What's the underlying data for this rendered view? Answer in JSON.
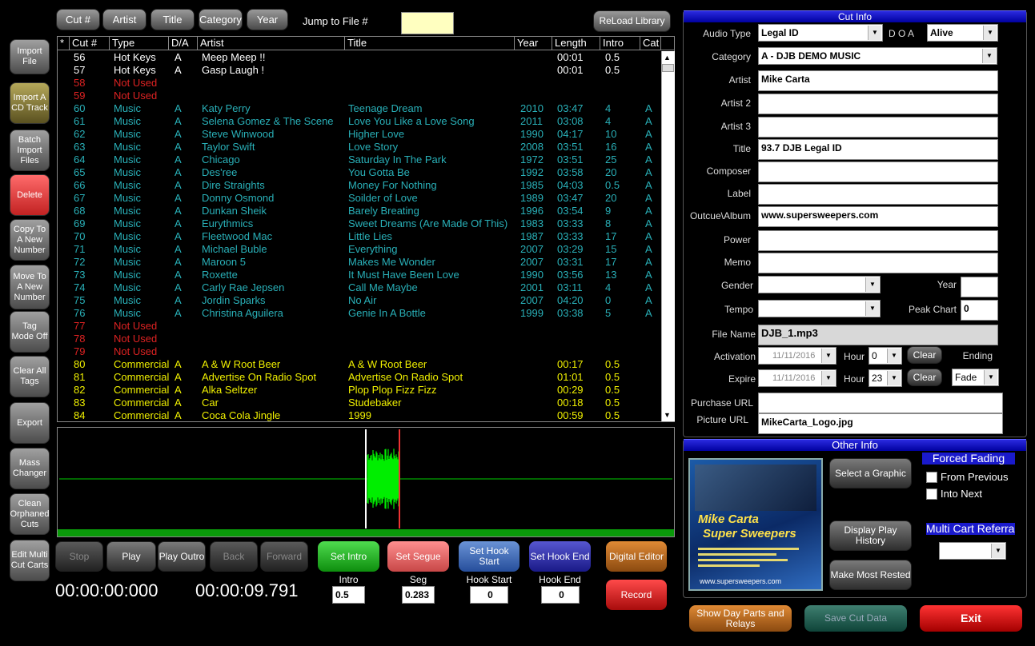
{
  "toolbar": {
    "cut": "Cut #",
    "artist": "Artist",
    "title": "Title",
    "category": "Category",
    "year": "Year",
    "jump_label": "Jump to  File #",
    "jump_value": "",
    "reload": "ReLoad Library"
  },
  "sidebar": [
    "Import File",
    "Import A CD Track",
    "Batch Import Files",
    "Delete",
    "Copy To A New Number",
    "Move To A New Number",
    "Tag Mode Off",
    "Clear All Tags",
    "Export",
    "Mass Changer",
    "Clean Orphaned Cuts",
    "Edit Multi Cut Carts"
  ],
  "table": {
    "headers": [
      "*",
      "Cut #",
      "Type",
      "D/A",
      "Artist",
      "Title",
      "Year",
      "Length",
      "Intro",
      "Cat"
    ],
    "rows": [
      {
        "cut": "56",
        "type": "Hot Keys",
        "da": "A",
        "artist": "Meep Meep !!",
        "title": "",
        "year": "",
        "length": "00:01",
        "intro": "0.5",
        "cat": "",
        "color": "white"
      },
      {
        "cut": "57",
        "type": "Hot Keys",
        "da": "A",
        "artist": "Gasp Laugh !",
        "title": "",
        "year": "",
        "length": "00:01",
        "intro": "0.5",
        "cat": "",
        "color": "white"
      },
      {
        "cut": "58",
        "type": "Not Used",
        "da": "",
        "artist": "",
        "title": "",
        "year": "",
        "length": "",
        "intro": "",
        "cat": "",
        "color": "red"
      },
      {
        "cut": "59",
        "type": "Not Used",
        "da": "",
        "artist": "",
        "title": "",
        "year": "",
        "length": "",
        "intro": "",
        "cat": "",
        "color": "red"
      },
      {
        "cut": "60",
        "type": "Music",
        "da": "A",
        "artist": "Katy Perry",
        "title": "Teenage Dream",
        "year": "2010",
        "length": "03:47",
        "intro": "4",
        "cat": "A",
        "color": "teal"
      },
      {
        "cut": "61",
        "type": "Music",
        "da": "A",
        "artist": "Selena Gomez & The Scene",
        "title": "Love You Like a Love Song",
        "year": "2011",
        "length": "03:08",
        "intro": "4",
        "cat": "A",
        "color": "teal"
      },
      {
        "cut": "62",
        "type": "Music",
        "da": "A",
        "artist": "Steve Winwood",
        "title": "Higher Love",
        "year": "1990",
        "length": "04:17",
        "intro": "10",
        "cat": "A",
        "color": "teal"
      },
      {
        "cut": "63",
        "type": "Music",
        "da": "A",
        "artist": "Taylor Swift",
        "title": "Love Story",
        "year": "2008",
        "length": "03:51",
        "intro": "16",
        "cat": "A",
        "color": "teal"
      },
      {
        "cut": "64",
        "type": "Music",
        "da": "A",
        "artist": "Chicago",
        "title": "Saturday In The Park",
        "year": "1972",
        "length": "03:51",
        "intro": "25",
        "cat": "A",
        "color": "teal"
      },
      {
        "cut": "65",
        "type": "Music",
        "da": "A",
        "artist": "Des'ree",
        "title": "You Gotta Be",
        "year": "1992",
        "length": "03:58",
        "intro": "20",
        "cat": "A",
        "color": "teal"
      },
      {
        "cut": "66",
        "type": "Music",
        "da": "A",
        "artist": "Dire Straights",
        "title": "Money For Nothing",
        "year": "1985",
        "length": "04:03",
        "intro": "0.5",
        "cat": "A",
        "color": "teal"
      },
      {
        "cut": "67",
        "type": "Music",
        "da": "A",
        "artist": "Donny Osmond",
        "title": "Soilder of Love",
        "year": "1989",
        "length": "03:47",
        "intro": "20",
        "cat": "A",
        "color": "teal"
      },
      {
        "cut": "68",
        "type": "Music",
        "da": "A",
        "artist": "Dunkan Sheik",
        "title": "Barely Breating",
        "year": "1996",
        "length": "03:54",
        "intro": "9",
        "cat": "A",
        "color": "teal"
      },
      {
        "cut": "69",
        "type": "Music",
        "da": "A",
        "artist": "Eurythmics",
        "title": "Sweet Dreams (Are Made Of This)",
        "year": "1983",
        "length": "03:33",
        "intro": "8",
        "cat": "A",
        "color": "teal"
      },
      {
        "cut": "70",
        "type": "Music",
        "da": "A",
        "artist": "Fleetwood Mac",
        "title": "Little Lies",
        "year": "1987",
        "length": "03:33",
        "intro": "17",
        "cat": "A",
        "color": "teal"
      },
      {
        "cut": "71",
        "type": "Music",
        "da": "A",
        "artist": "Michael Buble",
        "title": "Everything",
        "year": "2007",
        "length": "03:29",
        "intro": "15",
        "cat": "A",
        "color": "teal"
      },
      {
        "cut": "72",
        "type": "Music",
        "da": "A",
        "artist": "Maroon 5",
        "title": "Makes Me Wonder",
        "year": "2007",
        "length": "03:31",
        "intro": "17",
        "cat": "A",
        "color": "teal"
      },
      {
        "cut": "73",
        "type": "Music",
        "da": "A",
        "artist": "Roxette",
        "title": "It Must Have Been Love",
        "year": "1990",
        "length": "03:56",
        "intro": "13",
        "cat": "A",
        "color": "teal"
      },
      {
        "cut": "74",
        "type": "Music",
        "da": "A",
        "artist": "Carly Rae Jepsen",
        "title": "Call Me Maybe",
        "year": "2001",
        "length": "03:11",
        "intro": "4",
        "cat": "A",
        "color": "teal"
      },
      {
        "cut": "75",
        "type": "Music",
        "da": "A",
        "artist": "Jordin Sparks",
        "title": "No Air",
        "year": "2007",
        "length": "04:20",
        "intro": "0",
        "cat": "A",
        "color": "teal"
      },
      {
        "cut": "76",
        "type": "Music",
        "da": "A",
        "artist": "Christina Aguilera",
        "title": "Genie In A Bottle",
        "year": "1999",
        "length": "03:38",
        "intro": "5",
        "cat": "A",
        "color": "teal"
      },
      {
        "cut": "77",
        "type": "Not Used",
        "da": "",
        "artist": "",
        "title": "",
        "year": "",
        "length": "",
        "intro": "",
        "cat": "",
        "color": "red"
      },
      {
        "cut": "78",
        "type": "Not Used",
        "da": "",
        "artist": "",
        "title": "",
        "year": "",
        "length": "",
        "intro": "",
        "cat": "",
        "color": "red"
      },
      {
        "cut": "79",
        "type": "Not Used",
        "da": "",
        "artist": "",
        "title": "",
        "year": "",
        "length": "",
        "intro": "",
        "cat": "",
        "color": "red"
      },
      {
        "cut": "80",
        "type": "Commercial",
        "da": "A",
        "artist": "A & W Root Beer",
        "title": "A & W Root Beer",
        "year": "",
        "length": "00:17",
        "intro": "0.5",
        "cat": "",
        "color": "yellow"
      },
      {
        "cut": "81",
        "type": "Commercial",
        "da": "A",
        "artist": "Advertise On Radio Spot",
        "title": "Advertise On Radio Spot",
        "year": "",
        "length": "01:01",
        "intro": "0.5",
        "cat": "",
        "color": "yellow"
      },
      {
        "cut": "82",
        "type": "Commercial",
        "da": "A",
        "artist": "Alka Seltzer",
        "title": "Plop Plop Fizz Fizz",
        "year": "",
        "length": "00:29",
        "intro": "0.5",
        "cat": "",
        "color": "yellow"
      },
      {
        "cut": "83",
        "type": "Commercial",
        "da": "A",
        "artist": "Car",
        "title": "Studebaker",
        "year": "",
        "length": "00:18",
        "intro": "0.5",
        "cat": "",
        "color": "yellow"
      },
      {
        "cut": "84",
        "type": "Commercial",
        "da": "A",
        "artist": "Coca Cola Jingle",
        "title": "1999",
        "year": "",
        "length": "00:59",
        "intro": "0.5",
        "cat": "",
        "color": "yellow"
      }
    ]
  },
  "transport": {
    "stop": "Stop",
    "play": "Play",
    "play_outro": "Play Outro",
    "back": "Back",
    "forward": "Forward",
    "time_left": "00:00:00:000",
    "time_right": "00:00:09.791"
  },
  "markers": {
    "set_intro": "Set Intro",
    "set_segue": "Set Segue",
    "set_hook_start": "Set Hook Start",
    "set_hook_end": "Set Hook End",
    "digital_editor": "Digital Editor",
    "record": "Record",
    "intro_label": "Intro",
    "seg_label": "Seg",
    "hook_start_label": "Hook Start",
    "hook_end_label": "Hook End",
    "intro_value": "0.5",
    "seg_value": "0.283",
    "hook_start_value": "0",
    "hook_end_value": "0"
  },
  "cutinfo": {
    "title": "Cut Info",
    "audio_type_label": "Audio Type",
    "audio_type": "Legal ID",
    "doa_label": "D O A",
    "doa": "Alive",
    "category_label": "Category",
    "category": "A - DJB DEMO MUSIC",
    "artist_label": "Artist",
    "artist": "Mike Carta",
    "artist2_label": "Artist 2",
    "artist2": "",
    "artist3_label": "Artist 3",
    "artist3": "",
    "title_label": "Title",
    "title_value": "93.7 DJB Legal ID",
    "composer_label": "Composer",
    "composer": "",
    "label_label": "Label",
    "label": "",
    "outcue_label": "Outcue\\Album",
    "outcue": "www.supersweepers.com",
    "power_label": "Power",
    "power": "",
    "memo_label": "Memo",
    "memo": "",
    "gender_label": "Gender",
    "gender": "",
    "year_label": "Year",
    "year": "",
    "tempo_label": "Tempo",
    "tempo": "",
    "peak_label": "Peak Chart",
    "peak": "0",
    "filename_label": "File Name",
    "filename": "DJB_1.mp3",
    "activation_label": "Activation",
    "activation_date": "11/11/2016",
    "act_hour_label": "Hour",
    "act_hour": "0",
    "clear": "Clear",
    "ending_label": "Ending",
    "expire_label": "Expire",
    "expire_date": "11/11/2016",
    "exp_hour_label": "Hour",
    "exp_hour": "23",
    "ending": "Fade",
    "purchase_label": "Purchase URL",
    "purchase": "",
    "picture_label": "Picture URL",
    "picture": "MikeCarta_Logo.jpg"
  },
  "otherinfo": {
    "title": "Other Info",
    "select_graphic": "Select a Graphic",
    "display_history": "Display Play History",
    "make_rested": "Make Most Rested",
    "forced_fading": "Forced Fading",
    "from_previous": "From Previous",
    "into_next": "Into Next",
    "multi_cart": "Multi Cart Referra",
    "multi_cart_value": "",
    "logo_line1": "Mike Carta",
    "logo_line2": "Super Sweepers",
    "logo_url": "www.supersweepers.com"
  },
  "footer": {
    "day_parts": "Show Day Parts and Relays",
    "save": "Save Cut Data",
    "exit": "Exit"
  },
  "colors": {
    "white": "#ffffff",
    "red": "#d22222",
    "teal": "#29b0b8",
    "yellow": "#f0f000",
    "wave": "#00ee00"
  }
}
